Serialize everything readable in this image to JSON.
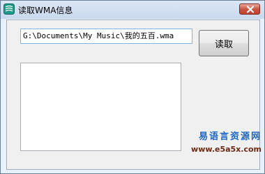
{
  "window": {
    "title": "读取WMA信息",
    "icon": "app-icon",
    "close_icon": "close-icon"
  },
  "form": {
    "path_value": "G:\\Documents\\My Music\\我的五百.wma",
    "read_button_label": "读取",
    "info_text": ""
  },
  "watermark": {
    "name": "易语言资源网",
    "url": "www.e5a5x.com"
  },
  "colors": {
    "accent": "#1d67c4",
    "input_border": "#7eb4ea",
    "close_button": "#c9513f"
  }
}
